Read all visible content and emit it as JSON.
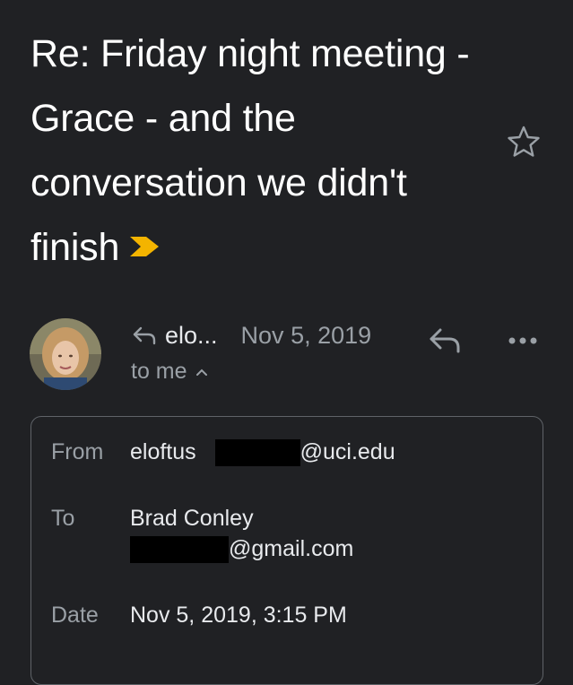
{
  "email": {
    "subject": "Re: Friday night meeting - Grace - and the conversation we didn't finish",
    "sender_short": "elo...",
    "date_short": "Nov 5, 2019",
    "to_line": "to me",
    "details": {
      "from_label": "From",
      "from_name": "eloftus",
      "from_domain": "@uci.edu",
      "to_label": "To",
      "to_name": "Brad Conley",
      "to_domain": "@gmail.com",
      "date_label": "Date",
      "date_value": "Nov 5, 2019, 3:15 PM"
    }
  },
  "icons": {
    "importance": "important-marker-icon",
    "star": "star-icon",
    "reply_small": "reply-indicator-icon",
    "reply": "reply-icon",
    "more": "more-options-icon",
    "caret": "caret-up-icon"
  },
  "colors": {
    "background": "#202124",
    "importance": "#f4b400",
    "primary_text": "#e8eaed",
    "secondary_text": "#9aa0a6"
  }
}
